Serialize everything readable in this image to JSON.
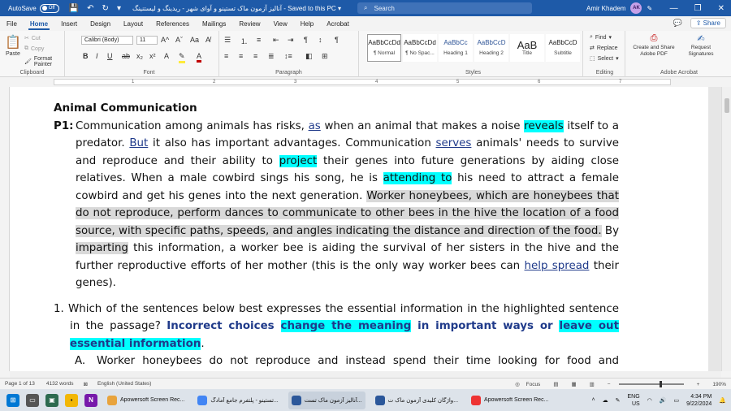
{
  "titlebar": {
    "autosave_label": "AutoSave",
    "autosave_state": "Off",
    "doc_title": "آنالیز آزمون ماک تستینو و آوای شهر - ریدینگ و لیستنینگ",
    "saved_status": "Saved to this PC",
    "search_placeholder": "Search",
    "user_name": "Amir Khadem",
    "user_initials": "AK",
    "accent_color": "#1e5aa8"
  },
  "menu": {
    "tabs": [
      "File",
      "Home",
      "Insert",
      "Design",
      "Layout",
      "References",
      "Mailings",
      "Review",
      "View",
      "Help",
      "Acrobat"
    ],
    "active_tab": "Home",
    "share_label": "Share"
  },
  "ribbon": {
    "clipboard": {
      "paste": "Paste",
      "cut": "Cut",
      "copy": "Copy",
      "format_painter": "Format Painter",
      "label": "Clipboard"
    },
    "font": {
      "font_name": "Calibri (Body)",
      "font_size": "11",
      "label": "Font"
    },
    "paragraph": {
      "label": "Paragraph"
    },
    "styles": {
      "label": "Styles",
      "items": [
        {
          "sample": "AaBbCcDd",
          "name": "¶ Normal"
        },
        {
          "sample": "AaBbCcDd",
          "name": "¶ No Spac..."
        },
        {
          "sample": "AaBbCc",
          "name": "Heading 1"
        },
        {
          "sample": "AaBbCcD",
          "name": "Heading 2"
        },
        {
          "sample": "AaB",
          "name": "Title"
        },
        {
          "sample": "AaBbCcD",
          "name": "Subtitle"
        }
      ]
    },
    "editing": {
      "find": "Find",
      "replace": "Replace",
      "select": "Select",
      "label": "Editing"
    },
    "acrobat": {
      "create_share": "Create and Share Adobe PDF",
      "request_signatures": "Request Signatures",
      "label": "Adobe Acrobat"
    }
  },
  "ruler": {
    "numbers": [
      "1",
      "2",
      "3",
      "4",
      "5",
      "6",
      "7"
    ]
  },
  "document": {
    "heading": "Animal Communication",
    "p1_label": "P1:",
    "p1": {
      "t1": "Communication among animals has risks, ",
      "u1": "as",
      "t2": " when an animal that makes a noise ",
      "h1": "reveals",
      "t3": " itself to a predator. ",
      "u2": "But",
      "t4": " it also has important advantages. Communication ",
      "u3": "serves",
      "t5": " animals' needs to survive and reproduce and their ability to ",
      "h2": "project",
      "t6": " their genes into future generations by aiding close relatives. When a male cowbird sings his song, he is ",
      "h3": "attending to",
      "t7": " his need to attract a female cowbird and get his genes into the next generation. ",
      "g1": "Worker honeybees, which are honeybees that do not reproduce, perform dances to communicate to other bees in the hive the location of a food source, with specific paths, speeds, and angles indicating the distance and direction of the food.",
      "t8": " By ",
      "g2": "imparting",
      "t9": " this information, a worker bee is aiding the survival of her sisters in the hive and the further reproductive efforts of her mother (this is the only way worker bees can ",
      "u4": "help spread",
      "t10": " their genes)."
    },
    "question1": {
      "number": "1.",
      "text": " Which of the sentences below best expresses the essential information in the highlighted sentence in the passage? ",
      "b1": "Incorrect choices ",
      "bh1": "change the meaning",
      "b2": " in important ways or ",
      "bh2": "leave out essential information",
      "end": "."
    },
    "option_a": {
      "label": "A.",
      "text": "Worker honeybees do not reproduce and instead spend their time looking for food and performing a variety of dances."
    }
  },
  "status": {
    "page": "Page 1 of 13",
    "words": "4132 words",
    "language": "English (United States)",
    "focus": "Focus",
    "zoom": "190%"
  },
  "taskbar": {
    "apps": [
      {
        "name": "Apowersoft Screen Rec...",
        "active": false
      },
      {
        "name": "تستینو - پلتفرم جامع آمادگ...",
        "active": false
      },
      {
        "name": "آنالیز آزمون ماک تست...",
        "active": true
      },
      {
        "name": "واژگان کلیدی آزمون ماک ت...",
        "active": false
      },
      {
        "name": "Apowersoft Screen Rec...",
        "active": false
      }
    ],
    "lang": "ENG",
    "region": "US",
    "time": "4:34 PM",
    "date": "9/22/2024"
  }
}
